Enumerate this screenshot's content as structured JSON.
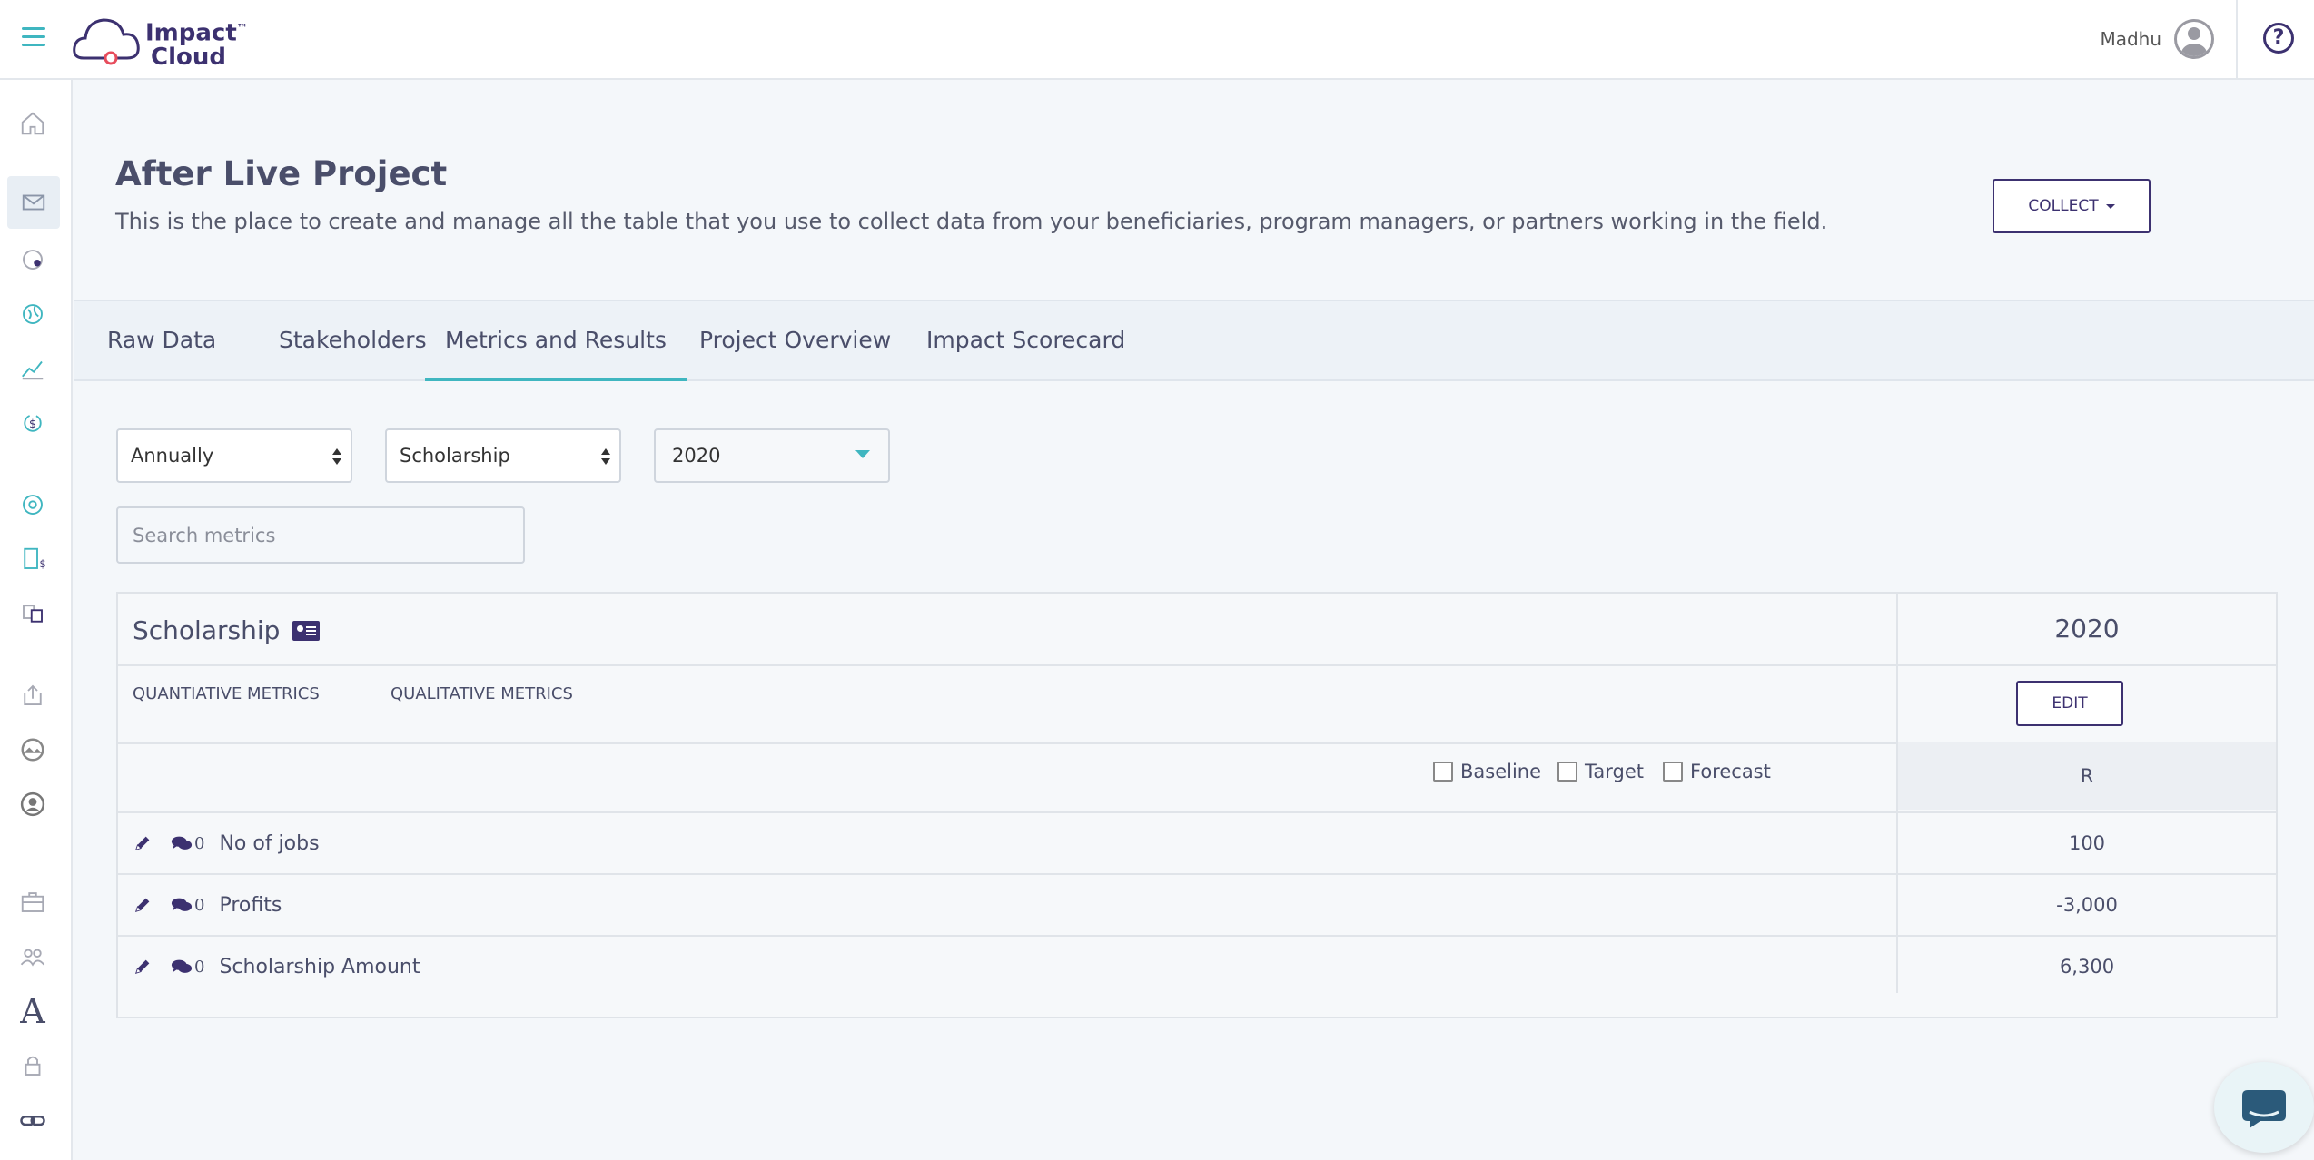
{
  "app": {
    "logo_line1": "Impact",
    "logo_line2": "Cloud",
    "logo_tm": "™",
    "user_name": "Madhu",
    "help_glyph": "?"
  },
  "page": {
    "title": "After Live Project",
    "description": "This is the place to create and manage all the table that you use to collect data from your beneficiaries, program managers, or partners working in the field.",
    "collect_label": "COLLECT"
  },
  "tabs": [
    {
      "label": "Raw Data"
    },
    {
      "label": "Stakeholders"
    },
    {
      "label": "Metrics and Results"
    },
    {
      "label": "Project Overview"
    },
    {
      "label": "Impact Scorecard"
    }
  ],
  "active_tab": "Metrics and Results",
  "filters": {
    "period": "Annually",
    "category": "Scholarship",
    "year": "2020",
    "search_placeholder": "Search metrics"
  },
  "table": {
    "section_title": "Scholarship",
    "year_header": "2020",
    "metric_tab_quant": "QUANTIATIVE METRICS",
    "metric_tab_qual": "QUALITATIVE METRICS",
    "edit_label": "EDIT",
    "checkbox_baseline": "Baseline",
    "checkbox_target": "Target",
    "checkbox_forecast": "Forecast",
    "column_unit": "R",
    "rows": [
      {
        "label": "No of jobs",
        "comments": "0",
        "value": "100"
      },
      {
        "label": "Profits",
        "comments": "0",
        "value": "-3,000"
      },
      {
        "label": "Scholarship Amount",
        "comments": "0",
        "value": "6,300"
      }
    ]
  },
  "colors": {
    "accent_teal": "#3fb6c0",
    "brand_purple": "#3c3170"
  },
  "sidebar_icons": [
    "home-icon",
    "inbox-icon",
    "globe-icon",
    "world-icon",
    "chart-line-icon",
    "dollar-cycle-icon",
    "support-icon",
    "report-dollar-icon",
    "translate-icon",
    "upload-icon",
    "landscape-icon",
    "user-circle-icon",
    "briefcase-icon",
    "users-icon",
    "font-icon",
    "lock-icon",
    "link-icon"
  ]
}
